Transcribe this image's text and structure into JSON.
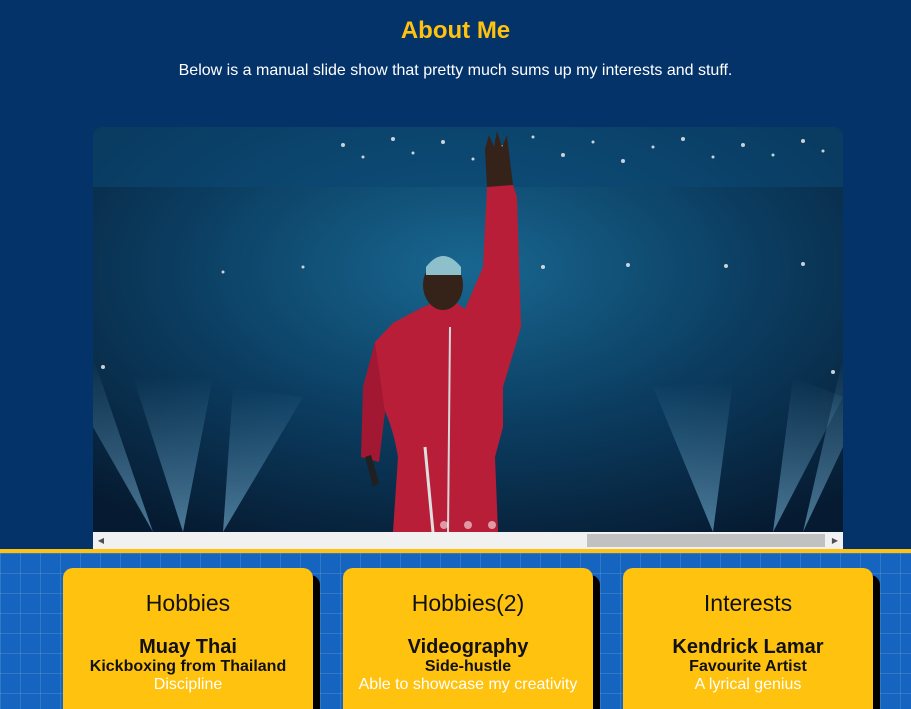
{
  "header": {
    "title": "About Me",
    "subtitle": "Below is a manual slide show that pretty much sums up my interests and stuff."
  },
  "slideshow": {
    "image": "concert-performer-red-tracksuit",
    "dot_count": 3
  },
  "cards": [
    {
      "heading": "Hobbies",
      "name": "Muay Thai",
      "role": "Kickboxing from Thailand",
      "desc": "Discipline"
    },
    {
      "heading": "Hobbies(2)",
      "name": "Videography",
      "role": "Side-hustle",
      "desc": "Able to showcase my creativity"
    },
    {
      "heading": "Interests",
      "name": "Kendrick Lamar",
      "role": "Favourite Artist",
      "desc": "A lyrical genius"
    }
  ],
  "colors": {
    "background": "#04336a",
    "accent": "#ffc20e",
    "grid_blue": "#1565c0"
  }
}
